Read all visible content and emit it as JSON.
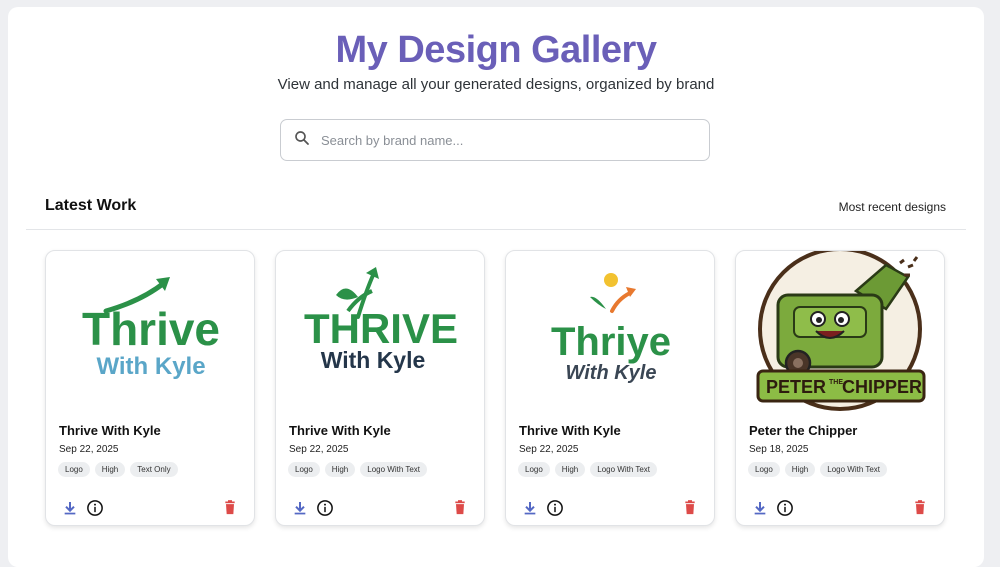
{
  "header": {
    "title": "My Design Gallery",
    "subtitle": "View and manage all your generated designs, organized by brand"
  },
  "search": {
    "placeholder": "Search by brand name...",
    "value": ""
  },
  "section": {
    "title": "Latest Work",
    "subtitle": "Most recent designs"
  },
  "colors": {
    "accent": "#6a5fb8",
    "download": "#5468c4",
    "delete": "#dd4a48",
    "brand_green": "#2b9148",
    "brand_blue": "#5aa6c8"
  },
  "cards": [
    {
      "name": "Thrive With Kyle",
      "date": "Sep 22, 2025",
      "tags": [
        "Logo",
        "High",
        "Text Only"
      ],
      "logo": {
        "line1": "Thrive",
        "line2": "With Kyle"
      }
    },
    {
      "name": "Thrive With Kyle",
      "date": "Sep 22, 2025",
      "tags": [
        "Logo",
        "High",
        "Logo With Text"
      ],
      "logo": {
        "line1": "THRIVE",
        "line2": "With Kyle"
      }
    },
    {
      "name": "Thrive With Kyle",
      "date": "Sep 22, 2025",
      "tags": [
        "Logo",
        "High",
        "Logo With Text"
      ],
      "logo": {
        "line1": "Thriye",
        "line2": "With Kyle"
      }
    },
    {
      "name": "Peter the Chipper",
      "date": "Sep 18, 2025",
      "tags": [
        "Logo",
        "High",
        "Logo With Text"
      ],
      "logo": {
        "line1": "PETER",
        "line2": "THE",
        "line3": "CHIPPER"
      }
    }
  ],
  "icons": {
    "search": "search-icon",
    "download": "download-icon",
    "info": "info-icon",
    "delete": "trash-icon"
  }
}
